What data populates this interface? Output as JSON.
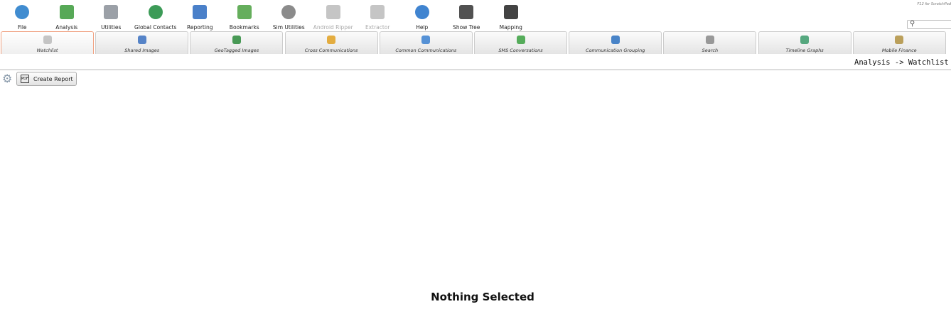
{
  "toolbar": [
    {
      "label": "File",
      "icon": "file-target-icon",
      "color": "#1e78c8"
    },
    {
      "label": "Analysis",
      "icon": "analysis-chart-icon",
      "color": "#3a9a3a"
    },
    {
      "label": "Utilities",
      "icon": "toolbox-icon",
      "color": "#8a8f98"
    },
    {
      "label": "Global Contacts",
      "icon": "globe-network-icon",
      "color": "#1a8a3a"
    },
    {
      "label": "Reporting",
      "icon": "file-cabinet-icon",
      "color": "#2a6ac0"
    },
    {
      "label": "Bookmarks",
      "icon": "bookmarks-icon",
      "color": "#4aa040"
    },
    {
      "label": "Sim Utilities",
      "icon": "sim-card-icon",
      "color": "#777"
    },
    {
      "label": "Android Ripper",
      "icon": "android-icon",
      "color": "#bbb",
      "disabled": true
    },
    {
      "label": "Extractor",
      "icon": "extractor-dots-icon",
      "color": "#bbb",
      "disabled": true
    },
    {
      "label": "Help",
      "icon": "help-icon",
      "color": "#1e6ec8"
    },
    {
      "label": "Show Tree",
      "icon": "tree-icon",
      "color": "#333"
    },
    {
      "label": "Mapping",
      "icon": "map-icon",
      "color": "#222"
    }
  ],
  "hint": "F12 for ScratchPad",
  "tabs": [
    {
      "label": "Watchlist",
      "icon": "flag-icon",
      "color": "#bbb",
      "active": true
    },
    {
      "label": "Shared Images",
      "icon": "images-icon",
      "color": "#3a70c0"
    },
    {
      "label": "GeoTagged Images",
      "icon": "globe-icon",
      "color": "#2a8a3a"
    },
    {
      "label": "Cross Communications",
      "icon": "cross-comm-icon",
      "color": "#e0a020"
    },
    {
      "label": "Common Communications",
      "icon": "venn-icon",
      "color": "#3a80d0"
    },
    {
      "label": "SMS Conversations",
      "icon": "sms-refresh-icon",
      "color": "#3aa040"
    },
    {
      "label": "Communication Grouping",
      "icon": "grouping-icon",
      "color": "#2a70c0"
    },
    {
      "label": "Search",
      "icon": "search-doc-icon",
      "color": "#888"
    },
    {
      "label": "Timeline Graphs",
      "icon": "timeline-icon",
      "color": "#3a9a6a"
    },
    {
      "label": "Mobile Finance",
      "icon": "finance-icon",
      "color": "#b09040"
    }
  ],
  "breadcrumb": "Analysis -> Watchlist",
  "create_report": "Create Report",
  "pdf_label": "PDF",
  "empty_message": "Nothing Selected"
}
